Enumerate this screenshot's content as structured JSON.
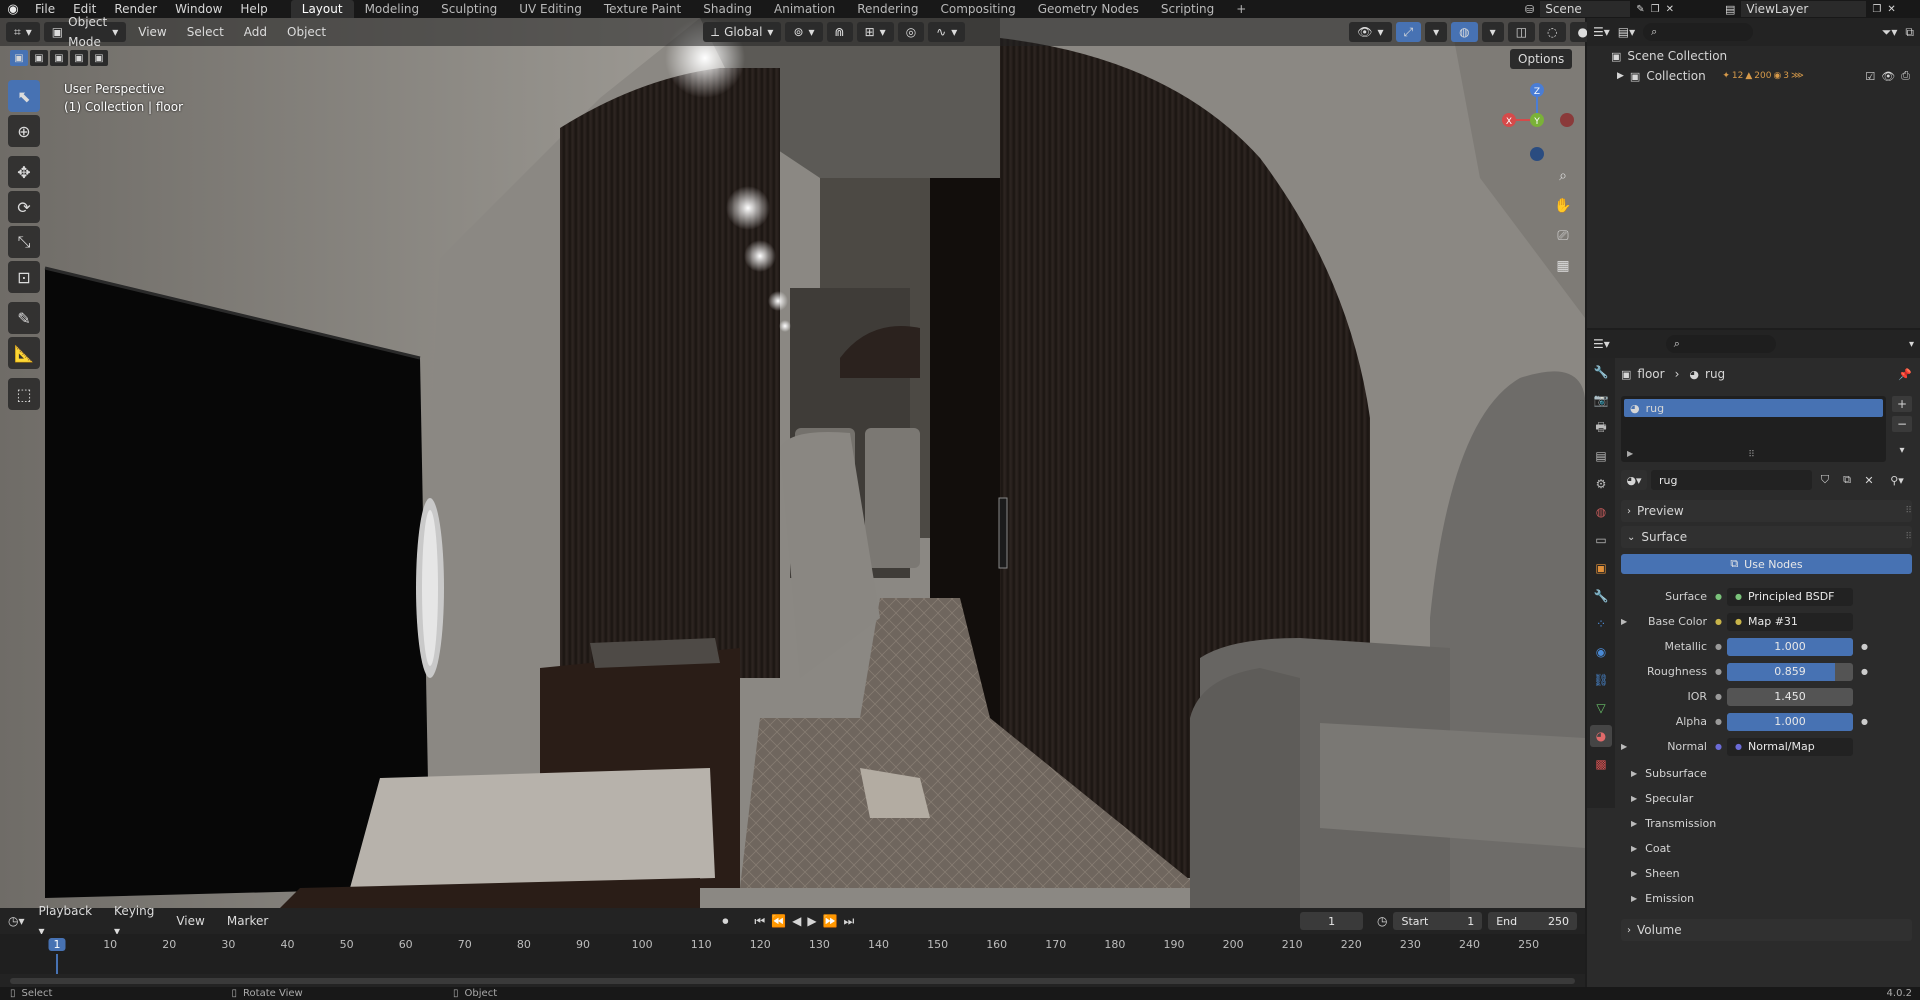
{
  "topbar": {
    "menus": [
      "File",
      "Edit",
      "Render",
      "Window",
      "Help"
    ],
    "workspaces": [
      "Layout",
      "Modeling",
      "Sculpting",
      "UV Editing",
      "Texture Paint",
      "Shading",
      "Animation",
      "Rendering",
      "Compositing",
      "Geometry Nodes",
      "Scripting"
    ],
    "active_workspace": "Layout",
    "scene": "Scene",
    "view_layer": "ViewLayer"
  },
  "viewport_header": {
    "mode": "Object Mode",
    "menus": [
      "View",
      "Select",
      "Add",
      "Object"
    ],
    "transform_orientation": "Global",
    "options_label": "Options"
  },
  "viewport": {
    "perspective_label": "User Perspective",
    "collection_label": "(1) Collection | floor",
    "gizmo": {
      "x": "X",
      "y": "Y",
      "z": "Z"
    }
  },
  "outliner": {
    "scene_collection": "Scene Collection",
    "collection": "Collection",
    "collection_counts": [
      "12",
      "200",
      "3"
    ]
  },
  "properties": {
    "breadcrumb": {
      "object": "floor",
      "material": "rug"
    },
    "material_slot": "rug",
    "material_name": "rug",
    "sections": {
      "preview": "Preview",
      "surface": "Surface"
    },
    "use_nodes_label": "Use Nodes",
    "fields": [
      {
        "label": "Surface",
        "value": "Principled BSDF",
        "kind": "node",
        "dot": "#7ac27a"
      },
      {
        "label": "Base Color",
        "value": "Map #31",
        "kind": "node",
        "dot": "#c8b44a",
        "expand": true
      },
      {
        "label": "Metallic",
        "value": "1.000",
        "kind": "slider",
        "fraction": 1.0
      },
      {
        "label": "Roughness",
        "value": "0.859",
        "kind": "slider",
        "fraction": 0.859
      },
      {
        "label": "IOR",
        "value": "1.450",
        "kind": "plain"
      },
      {
        "label": "Alpha",
        "value": "1.000",
        "kind": "slider",
        "fraction": 1.0
      },
      {
        "label": "Normal",
        "value": "Normal/Map",
        "kind": "node",
        "dot": "#6b6bd6",
        "expand": true
      }
    ],
    "subpanels": [
      "Subsurface",
      "Specular",
      "Transmission",
      "Coat",
      "Sheen",
      "Emission"
    ],
    "volume_label": "Volume"
  },
  "timeline": {
    "menus": [
      "Playback",
      "Keying",
      "View",
      "Marker"
    ],
    "current_frame": "1",
    "start_label": "Start",
    "start_value": "1",
    "end_label": "End",
    "end_value": "250",
    "ticks": [
      "1",
      "10",
      "20",
      "30",
      "40",
      "50",
      "60",
      "70",
      "80",
      "90",
      "100",
      "110",
      "120",
      "130",
      "140",
      "150",
      "160",
      "170",
      "180",
      "190",
      "200",
      "210",
      "220",
      "230",
      "240",
      "250"
    ]
  },
  "statusbar": {
    "hints": [
      "Select",
      "Rotate View",
      "Object"
    ],
    "version": "4.0.2"
  },
  "colors": {
    "accent": "#4772b3",
    "x_axis": "#d54a4a",
    "y_axis": "#7ab238",
    "z_axis": "#4a7dd5"
  }
}
